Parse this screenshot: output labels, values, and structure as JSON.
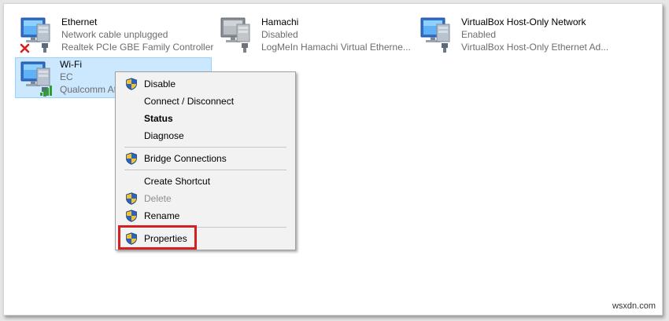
{
  "adapters": [
    {
      "name": "Ethernet",
      "status": "Network cable unplugged",
      "device": "Realtek PCIe GBE Family Controller"
    },
    {
      "name": "Hamachi",
      "status": "Disabled",
      "device": "LogMeIn Hamachi Virtual Etherne..."
    },
    {
      "name": "VirtualBox Host-Only Network",
      "status": "Enabled",
      "device": "VirtualBox Host-Only Ethernet Ad..."
    },
    {
      "name": "Wi-Fi",
      "status": "EC",
      "device": "Qualcomm At"
    }
  ],
  "menu": {
    "items": [
      {
        "label": "Disable"
      },
      {
        "label": "Connect / Disconnect"
      },
      {
        "label": "Status"
      },
      {
        "label": "Diagnose"
      },
      {
        "label": "Bridge Connections"
      },
      {
        "label": "Create Shortcut"
      },
      {
        "label": "Delete"
      },
      {
        "label": "Rename"
      },
      {
        "label": "Properties"
      }
    ]
  },
  "watermark": "wsxdn.com",
  "colors": {
    "selection": "#cce8ff",
    "highlight_box": "#d42020",
    "shield_blue": "#2d63b8",
    "shield_yellow": "#f2c12e"
  },
  "icons": [
    "network-adapter-icon",
    "disconnected-x-icon",
    "signal-bars-icon",
    "uac-shield-icon"
  ]
}
